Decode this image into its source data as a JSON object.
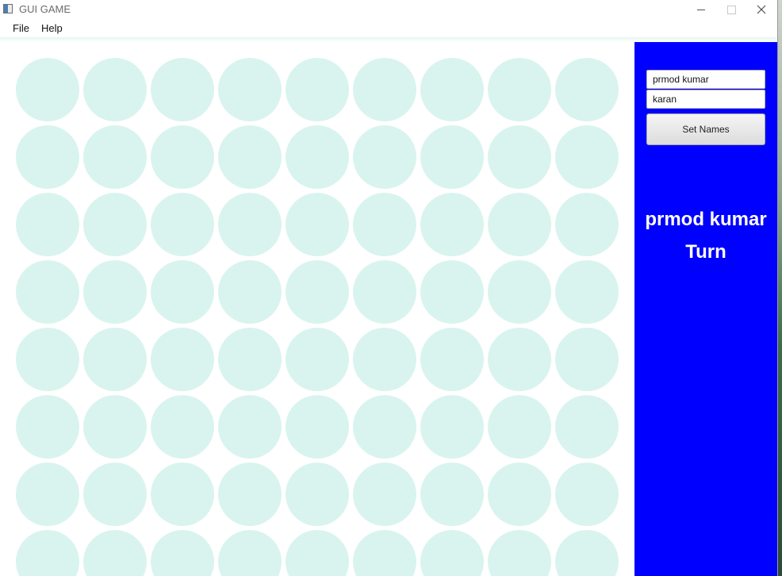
{
  "window": {
    "title": "GUI GAME",
    "controls": {
      "minimize_icon": "minimize-icon",
      "maximize_icon": "maximize-icon",
      "close_icon": "close-icon"
    }
  },
  "menu": {
    "items": [
      {
        "label": "File"
      },
      {
        "label": "Help"
      }
    ]
  },
  "board": {
    "columns": 9,
    "rows": 8,
    "empty_disc_color": "#d9f4ee",
    "background_color": "#ffffff"
  },
  "side_panel": {
    "background_color": "#0000ff",
    "player1_name": "prmod kumar",
    "player2_name": "karan",
    "set_names_label": "Set Names",
    "current_player": "prmod kumar",
    "turn_label": "Turn"
  }
}
